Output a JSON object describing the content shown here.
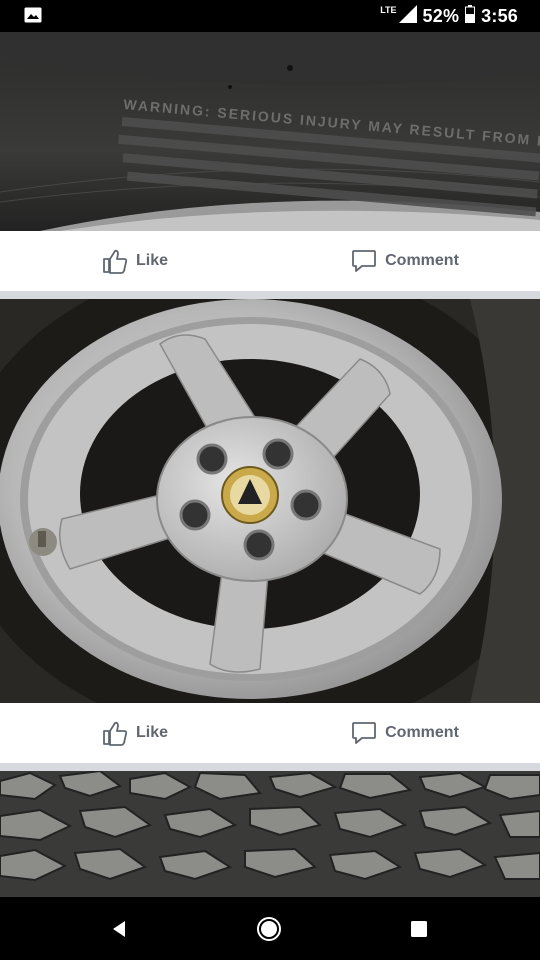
{
  "status_bar": {
    "network": "LTE",
    "battery": "52%",
    "time": "3:56",
    "icons": [
      "image-notification-icon",
      "signal-icon",
      "battery-icon"
    ]
  },
  "posts": [
    {
      "photo_icon": "tire-sidewall-photo",
      "sidewall_text": "WARNING: SERIOUS INJURY MAY RESULT FROM EX",
      "like_label": "Like",
      "comment_label": "Comment"
    },
    {
      "photo_icon": "alloy-wheel-photo",
      "like_label": "Like",
      "comment_label": "Comment"
    },
    {
      "photo_icon": "tire-tread-photo"
    }
  ],
  "nav": {
    "back_icon": "back-icon",
    "home_icon": "home-icon",
    "recents_icon": "recents-icon"
  },
  "colors": {
    "action_text": "#606770",
    "separator": "#d6d9dd",
    "status_bar": "#000000"
  }
}
